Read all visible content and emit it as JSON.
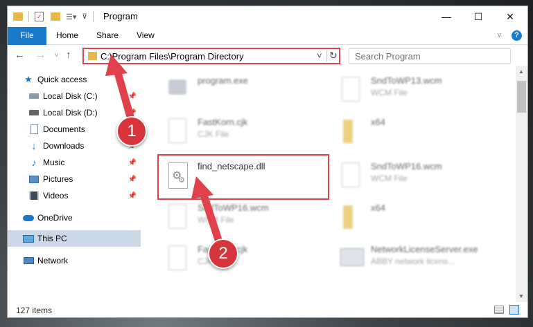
{
  "window": {
    "title": "Program",
    "minimize": "—",
    "maximize": "☐",
    "close": "✕"
  },
  "ribbon": {
    "tabs": [
      "File",
      "Home",
      "Share",
      "View"
    ],
    "expand": "˅",
    "help": "?"
  },
  "address": {
    "path": "C:\\Program Files\\Program Directory",
    "dropdown": "˅",
    "refresh": "↻"
  },
  "search": {
    "placeholder": "Search Program"
  },
  "nav_pane": {
    "items": [
      {
        "label": "Quick access",
        "icon": "star-icon"
      },
      {
        "label": "Local Disk (C:)",
        "icon": "disk-icon"
      },
      {
        "label": "Local Disk (D:)",
        "icon": "disk-icon"
      },
      {
        "label": "Documents",
        "icon": "documents-icon"
      },
      {
        "label": "Downloads",
        "icon": "download-icon"
      },
      {
        "label": "Music",
        "icon": "music-icon"
      },
      {
        "label": "Pictures",
        "icon": "pictures-icon"
      },
      {
        "label": "Videos",
        "icon": "videos-icon"
      },
      {
        "label": "OneDrive",
        "icon": "cloud-icon"
      },
      {
        "label": "This PC",
        "icon": "computer-icon"
      },
      {
        "label": "Network",
        "icon": "network-icon"
      }
    ]
  },
  "files": [
    {
      "name": "program.exe",
      "type": ""
    },
    {
      "name": "SndToWP13.wcm",
      "type": "WCM File"
    },
    {
      "name": "FastKorn.cjk",
      "type": "CJK File"
    },
    {
      "name": "x64",
      "type": ""
    },
    {
      "name": "find_netscape.dll",
      "type": ""
    },
    {
      "name": "SndToWP16.wcm",
      "type": "WCM File"
    },
    {
      "name": "SndToWP16.wcm",
      "type": "WCM File"
    },
    {
      "name": "x64",
      "type": ""
    },
    {
      "name": "FastKorn.cjk",
      "type": "CJK File"
    },
    {
      "name": "NetworkLicenseServer.exe",
      "type": "ABBY network licens..."
    }
  ],
  "status": {
    "item_count": "127 items"
  },
  "annotations": {
    "badge1": "1",
    "badge2": "2"
  },
  "colors": {
    "accent": "#1979ca",
    "highlight": "#e0414a",
    "selected": "#ccd8e6"
  }
}
